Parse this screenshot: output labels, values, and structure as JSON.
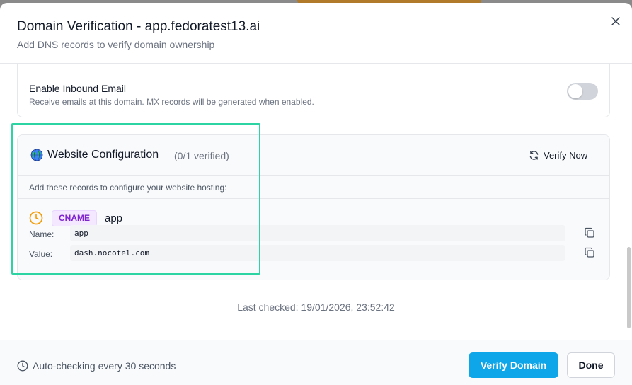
{
  "dialog": {
    "title": "Domain Verification - app.fedoratest13.ai",
    "subtitle": "Add DNS records to verify domain ownership",
    "close_icon": "close-icon"
  },
  "inbound_email": {
    "title": "Enable Inbound Email",
    "description": "Receive emails at this domain. MX records will be generated when enabled.",
    "enabled": false
  },
  "website_config": {
    "icon": "globe-icon",
    "title": "Website Configuration",
    "count": "(0/1 verified)",
    "verify_now_label": "Verify Now",
    "hint": "Add these records to configure your website hosting:",
    "record": {
      "status_icon": "clock-icon",
      "type": "CNAME",
      "host": "app",
      "name_label": "Name:",
      "name_value": "app",
      "value_label": "Value:",
      "value_value": "dash.nocotel.com"
    }
  },
  "last_checked": "Last checked: 19/01/2026, 23:52:42",
  "footer": {
    "auto_checking": "Auto-checking every 30 seconds",
    "verify_domain_label": "Verify Domain",
    "done_label": "Done"
  },
  "colors": {
    "primary": "#0ea5e9",
    "badge_text": "#7e22ce",
    "badge_bg": "#f3e8ff",
    "pending": "#f59e0b",
    "highlight": "#2dd4a3"
  }
}
